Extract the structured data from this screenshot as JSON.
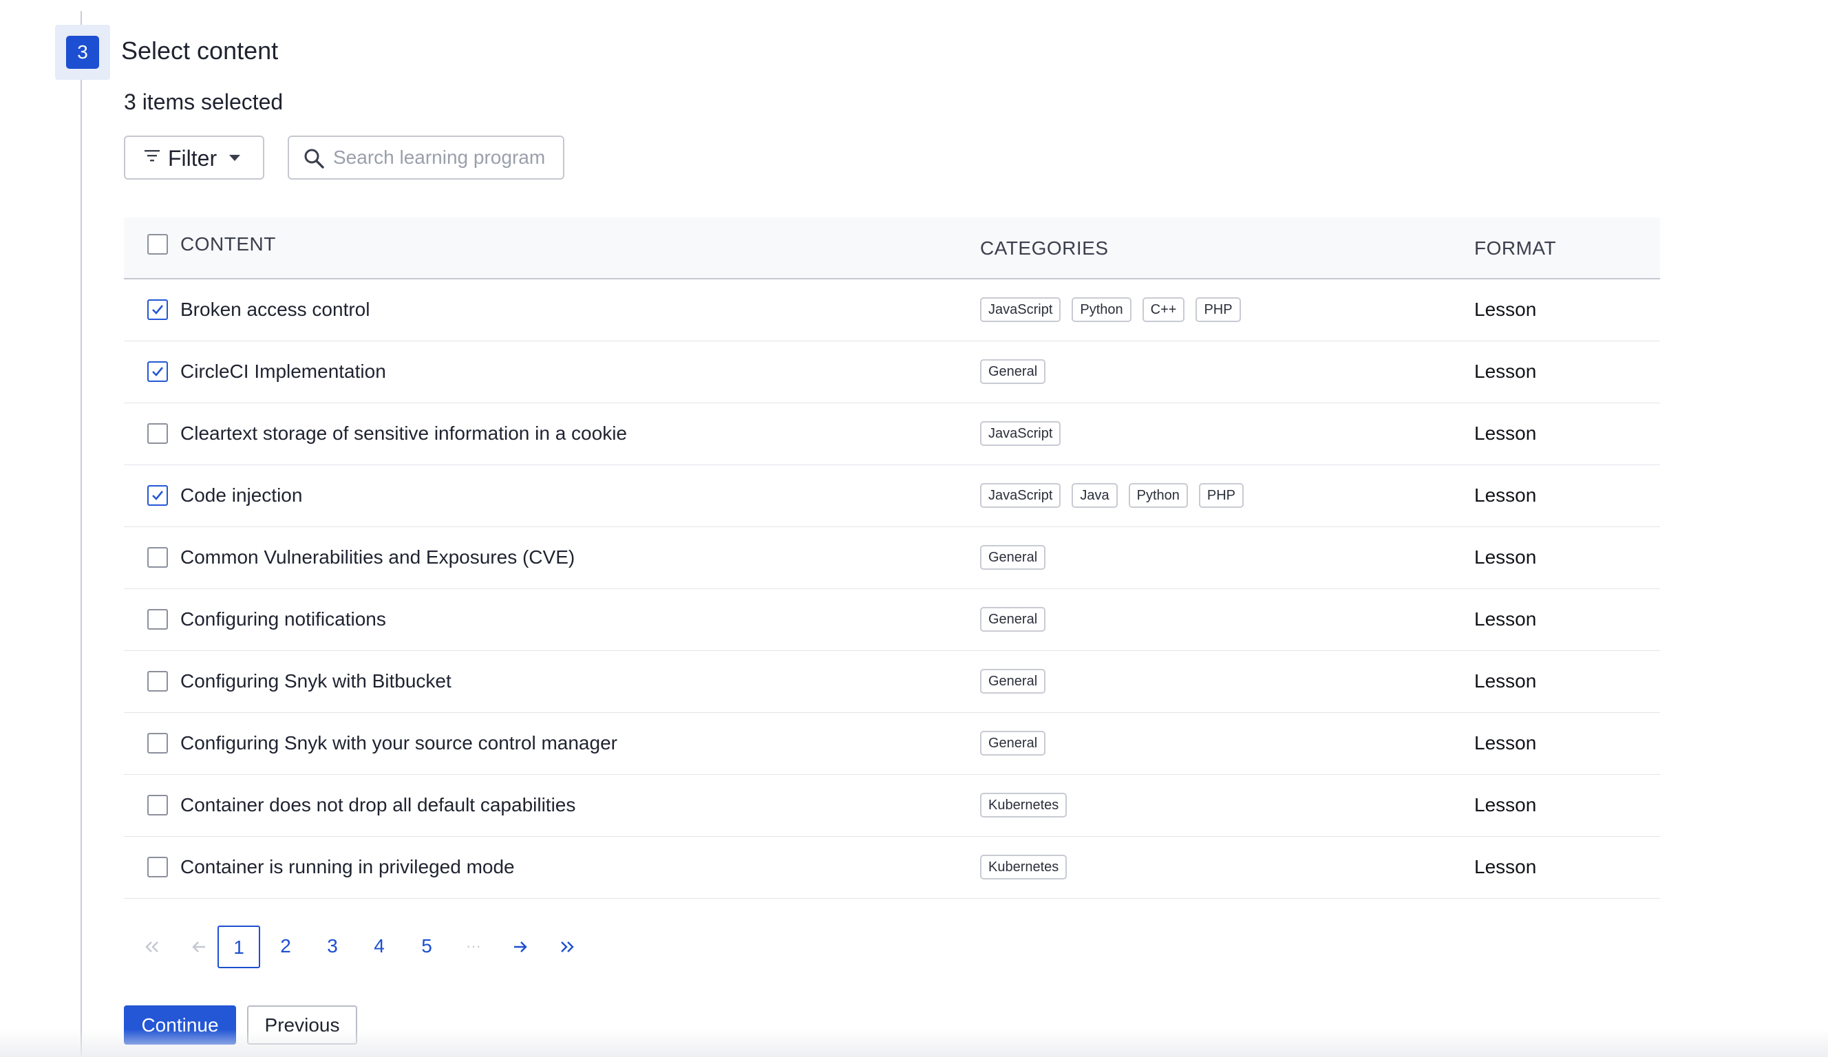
{
  "step": {
    "number": "3",
    "title": "Select content",
    "selected_count": "3 items selected"
  },
  "toolbar": {
    "filter_label": "Filter",
    "search_placeholder": "Search learning program",
    "search_value": ""
  },
  "table": {
    "columns": {
      "content": "CONTENT",
      "categories": "CATEGORIES",
      "format": "FORMAT"
    },
    "rows": [
      {
        "title": "Broken access control",
        "checked": true,
        "categories": [
          "JavaScript",
          "Python",
          "C++",
          "PHP"
        ],
        "format": "Lesson"
      },
      {
        "title": "CircleCI Implementation",
        "checked": true,
        "categories": [
          "General"
        ],
        "format": "Lesson"
      },
      {
        "title": "Cleartext storage of sensitive information in a cookie",
        "checked": false,
        "categories": [
          "JavaScript"
        ],
        "format": "Lesson"
      },
      {
        "title": "Code injection",
        "checked": true,
        "categories": [
          "JavaScript",
          "Java",
          "Python",
          "PHP"
        ],
        "format": "Lesson"
      },
      {
        "title": "Common Vulnerabilities and Exposures (CVE)",
        "checked": false,
        "categories": [
          "General"
        ],
        "format": "Lesson"
      },
      {
        "title": "Configuring notifications",
        "checked": false,
        "categories": [
          "General"
        ],
        "format": "Lesson"
      },
      {
        "title": "Configuring Snyk with Bitbucket",
        "checked": false,
        "categories": [
          "General"
        ],
        "format": "Lesson"
      },
      {
        "title": "Configuring Snyk with your source control manager",
        "checked": false,
        "categories": [
          "General"
        ],
        "format": "Lesson"
      },
      {
        "title": "Container does not drop all default capabilities",
        "checked": false,
        "categories": [
          "Kubernetes"
        ],
        "format": "Lesson"
      },
      {
        "title": "Container is running in privileged mode",
        "checked": false,
        "categories": [
          "Kubernetes"
        ],
        "format": "Lesson"
      }
    ]
  },
  "pagination": {
    "pages": [
      "1",
      "2",
      "3",
      "4",
      "5"
    ],
    "current": "1",
    "ellipsis": "···"
  },
  "actions": {
    "continue_label": "Continue",
    "previous_label": "Previous"
  },
  "colors": {
    "primary": "#2457d6",
    "step_badge": "#1c4fd1",
    "step_badge_bg": "#e6ecf8",
    "border": "#c5c8d0",
    "text": "#1f2330"
  },
  "icons": {
    "filter": "filter-icon",
    "caret": "caret-down-icon",
    "search": "search-icon",
    "check": "check-icon",
    "first": "double-chevron-left-icon",
    "prev": "arrow-left-icon",
    "next": "arrow-right-icon",
    "last": "double-chevron-right-icon"
  }
}
